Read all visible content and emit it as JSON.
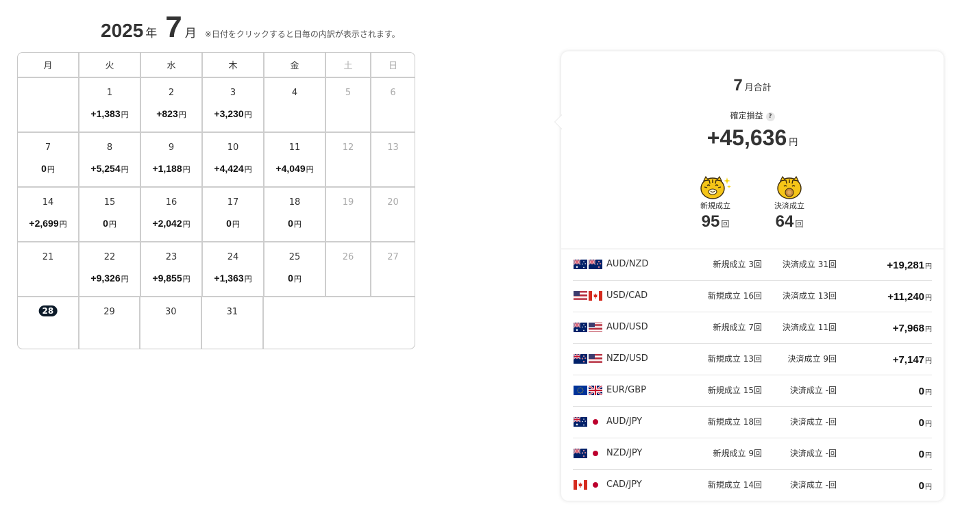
{
  "header": {
    "year": "2025",
    "year_suffix": "年",
    "month": "7",
    "month_suffix": "月",
    "note": "※日付をクリックすると日毎の内訳が表示されます。"
  },
  "calendar": {
    "weekdays": [
      "月",
      "火",
      "水",
      "木",
      "金",
      "土",
      "日"
    ],
    "yen": "円",
    "weeks": [
      [
        {
          "day": "",
          "value": ""
        },
        {
          "day": "1",
          "value": "+1,383"
        },
        {
          "day": "2",
          "value": "+823"
        },
        {
          "day": "3",
          "value": "+3,230"
        },
        {
          "day": "4",
          "value": ""
        },
        {
          "day": "5",
          "value": ""
        },
        {
          "day": "6",
          "value": ""
        }
      ],
      [
        {
          "day": "7",
          "value": "0"
        },
        {
          "day": "8",
          "value": "+5,254"
        },
        {
          "day": "9",
          "value": "+1,188"
        },
        {
          "day": "10",
          "value": "+4,424"
        },
        {
          "day": "11",
          "value": "+4,049"
        },
        {
          "day": "12",
          "value": ""
        },
        {
          "day": "13",
          "value": ""
        }
      ],
      [
        {
          "day": "14",
          "value": "+2,699"
        },
        {
          "day": "15",
          "value": "0"
        },
        {
          "day": "16",
          "value": "+2,042"
        },
        {
          "day": "17",
          "value": "0"
        },
        {
          "day": "18",
          "value": "0"
        },
        {
          "day": "19",
          "value": ""
        },
        {
          "day": "20",
          "value": ""
        }
      ],
      [
        {
          "day": "21",
          "value": ""
        },
        {
          "day": "22",
          "value": "+9,326"
        },
        {
          "day": "23",
          "value": "+9,855"
        },
        {
          "day": "24",
          "value": "+1,363"
        },
        {
          "day": "25",
          "value": "0"
        },
        {
          "day": "26",
          "value": ""
        },
        {
          "day": "27",
          "value": ""
        }
      ],
      [
        {
          "day": "28",
          "value": "",
          "today": true
        },
        {
          "day": "29",
          "value": ""
        },
        {
          "day": "30",
          "value": ""
        },
        {
          "day": "31",
          "value": ""
        }
      ]
    ]
  },
  "summary": {
    "month": "7",
    "month_total_label": "月合計",
    "pl_label": "確定損益",
    "help": "?",
    "pl_value": "+45,636",
    "yen": "円",
    "new_label": "新規成立",
    "new_count": "95",
    "close_label": "決済成立",
    "close_count": "64",
    "count_unit": "回",
    "pairs": [
      {
        "name": "AUD/NZD",
        "flags": [
          "au",
          "nz"
        ],
        "new": "新規成立 3回",
        "close": "決済成立 31回",
        "pl": "+19,281"
      },
      {
        "name": "USD/CAD",
        "flags": [
          "us",
          "ca"
        ],
        "new": "新規成立 16回",
        "close": "決済成立 13回",
        "pl": "+11,240"
      },
      {
        "name": "AUD/USD",
        "flags": [
          "au",
          "us"
        ],
        "new": "新規成立 7回",
        "close": "決済成立 11回",
        "pl": "+7,968"
      },
      {
        "name": "NZD/USD",
        "flags": [
          "nz",
          "us"
        ],
        "new": "新規成立 13回",
        "close": "決済成立 9回",
        "pl": "+7,147"
      },
      {
        "name": "EUR/GBP",
        "flags": [
          "eu",
          "gb"
        ],
        "new": "新規成立 15回",
        "close": "決済成立 -回",
        "pl": "0"
      },
      {
        "name": "AUD/JPY",
        "flags": [
          "au",
          "jp"
        ],
        "new": "新規成立 18回",
        "close": "決済成立 -回",
        "pl": "0"
      },
      {
        "name": "NZD/JPY",
        "flags": [
          "nz",
          "jp"
        ],
        "new": "新規成立 9回",
        "close": "決済成立 -回",
        "pl": "0"
      },
      {
        "name": "CAD/JPY",
        "flags": [
          "ca",
          "jp"
        ],
        "new": "新規成立 14回",
        "close": "決済成立 -回",
        "pl": "0"
      }
    ]
  }
}
